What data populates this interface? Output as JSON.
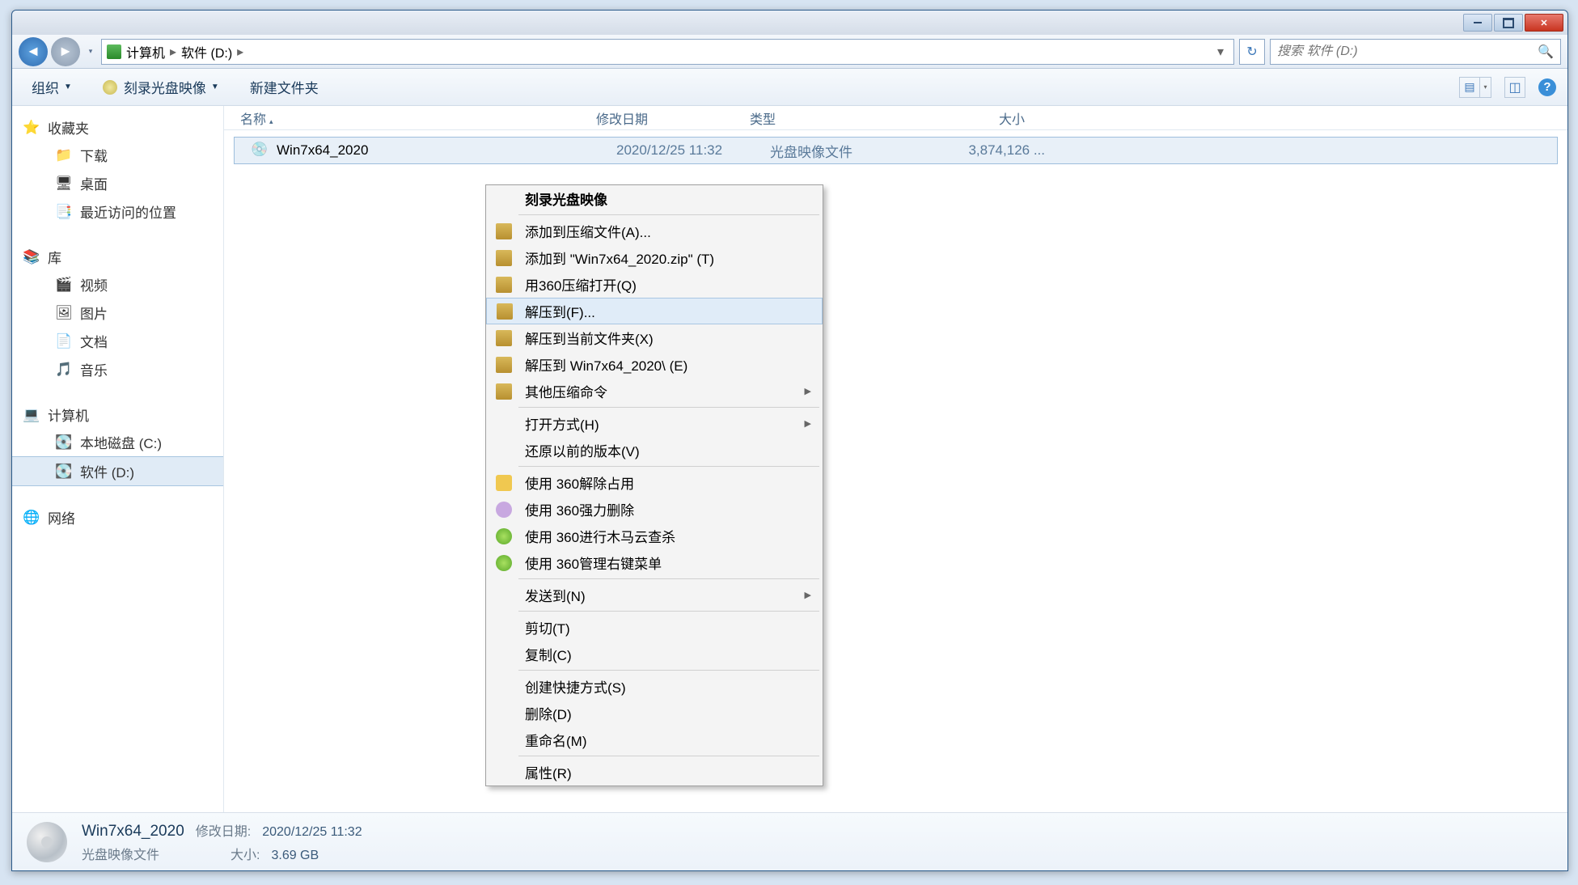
{
  "breadcrumb": {
    "root_icon": "computer",
    "parts": [
      "计算机",
      "软件 (D:)"
    ]
  },
  "search": {
    "placeholder": "搜索 软件 (D:)"
  },
  "toolbar": {
    "organize": "组织",
    "burn": "刻录光盘映像",
    "newfolder": "新建文件夹"
  },
  "sidebar": {
    "favorites": {
      "header": "收藏夹",
      "items": [
        "下载",
        "桌面",
        "最近访问的位置"
      ]
    },
    "libraries": {
      "header": "库",
      "items": [
        "视频",
        "图片",
        "文档",
        "音乐"
      ]
    },
    "computer": {
      "header": "计算机",
      "items": [
        "本地磁盘 (C:)",
        "软件 (D:)"
      ]
    },
    "network": {
      "header": "网络"
    }
  },
  "columns": {
    "name": "名称",
    "date": "修改日期",
    "type": "类型",
    "size": "大小"
  },
  "files": [
    {
      "name": "Win7x64_2020",
      "date": "2020/12/25 11:32",
      "type": "光盘映像文件",
      "size": "3,874,126 ..."
    }
  ],
  "context_menu": [
    {
      "label": "刻录光盘映像",
      "bold": true
    },
    {
      "sep": true
    },
    {
      "label": "添加到压缩文件(A)...",
      "icon": "zip"
    },
    {
      "label": "添加到 \"Win7x64_2020.zip\" (T)",
      "icon": "zip"
    },
    {
      "label": "用360压缩打开(Q)",
      "icon": "zip"
    },
    {
      "label": "解压到(F)...",
      "icon": "zip",
      "hover": true
    },
    {
      "label": "解压到当前文件夹(X)",
      "icon": "zip"
    },
    {
      "label": "解压到 Win7x64_2020\\ (E)",
      "icon": "zip"
    },
    {
      "label": "其他压缩命令",
      "icon": "zip",
      "submenu": true
    },
    {
      "sep": true
    },
    {
      "label": "打开方式(H)",
      "submenu": true
    },
    {
      "label": "还原以前的版本(V)"
    },
    {
      "sep": true
    },
    {
      "label": "使用 360解除占用",
      "icon": "360o"
    },
    {
      "label": "使用 360强力删除",
      "icon": "360p"
    },
    {
      "label": "使用 360进行木马云查杀",
      "icon": "360g"
    },
    {
      "label": "使用 360管理右键菜单",
      "icon": "360g"
    },
    {
      "sep": true
    },
    {
      "label": "发送到(N)",
      "submenu": true
    },
    {
      "sep": true
    },
    {
      "label": "剪切(T)"
    },
    {
      "label": "复制(C)"
    },
    {
      "sep": true
    },
    {
      "label": "创建快捷方式(S)"
    },
    {
      "label": "删除(D)"
    },
    {
      "label": "重命名(M)"
    },
    {
      "sep": true
    },
    {
      "label": "属性(R)"
    }
  ],
  "status": {
    "filename": "Win7x64_2020",
    "filetype": "光盘映像文件",
    "date_label": "修改日期:",
    "date_val": "2020/12/25 11:32",
    "size_label": "大小:",
    "size_val": "3.69 GB"
  }
}
